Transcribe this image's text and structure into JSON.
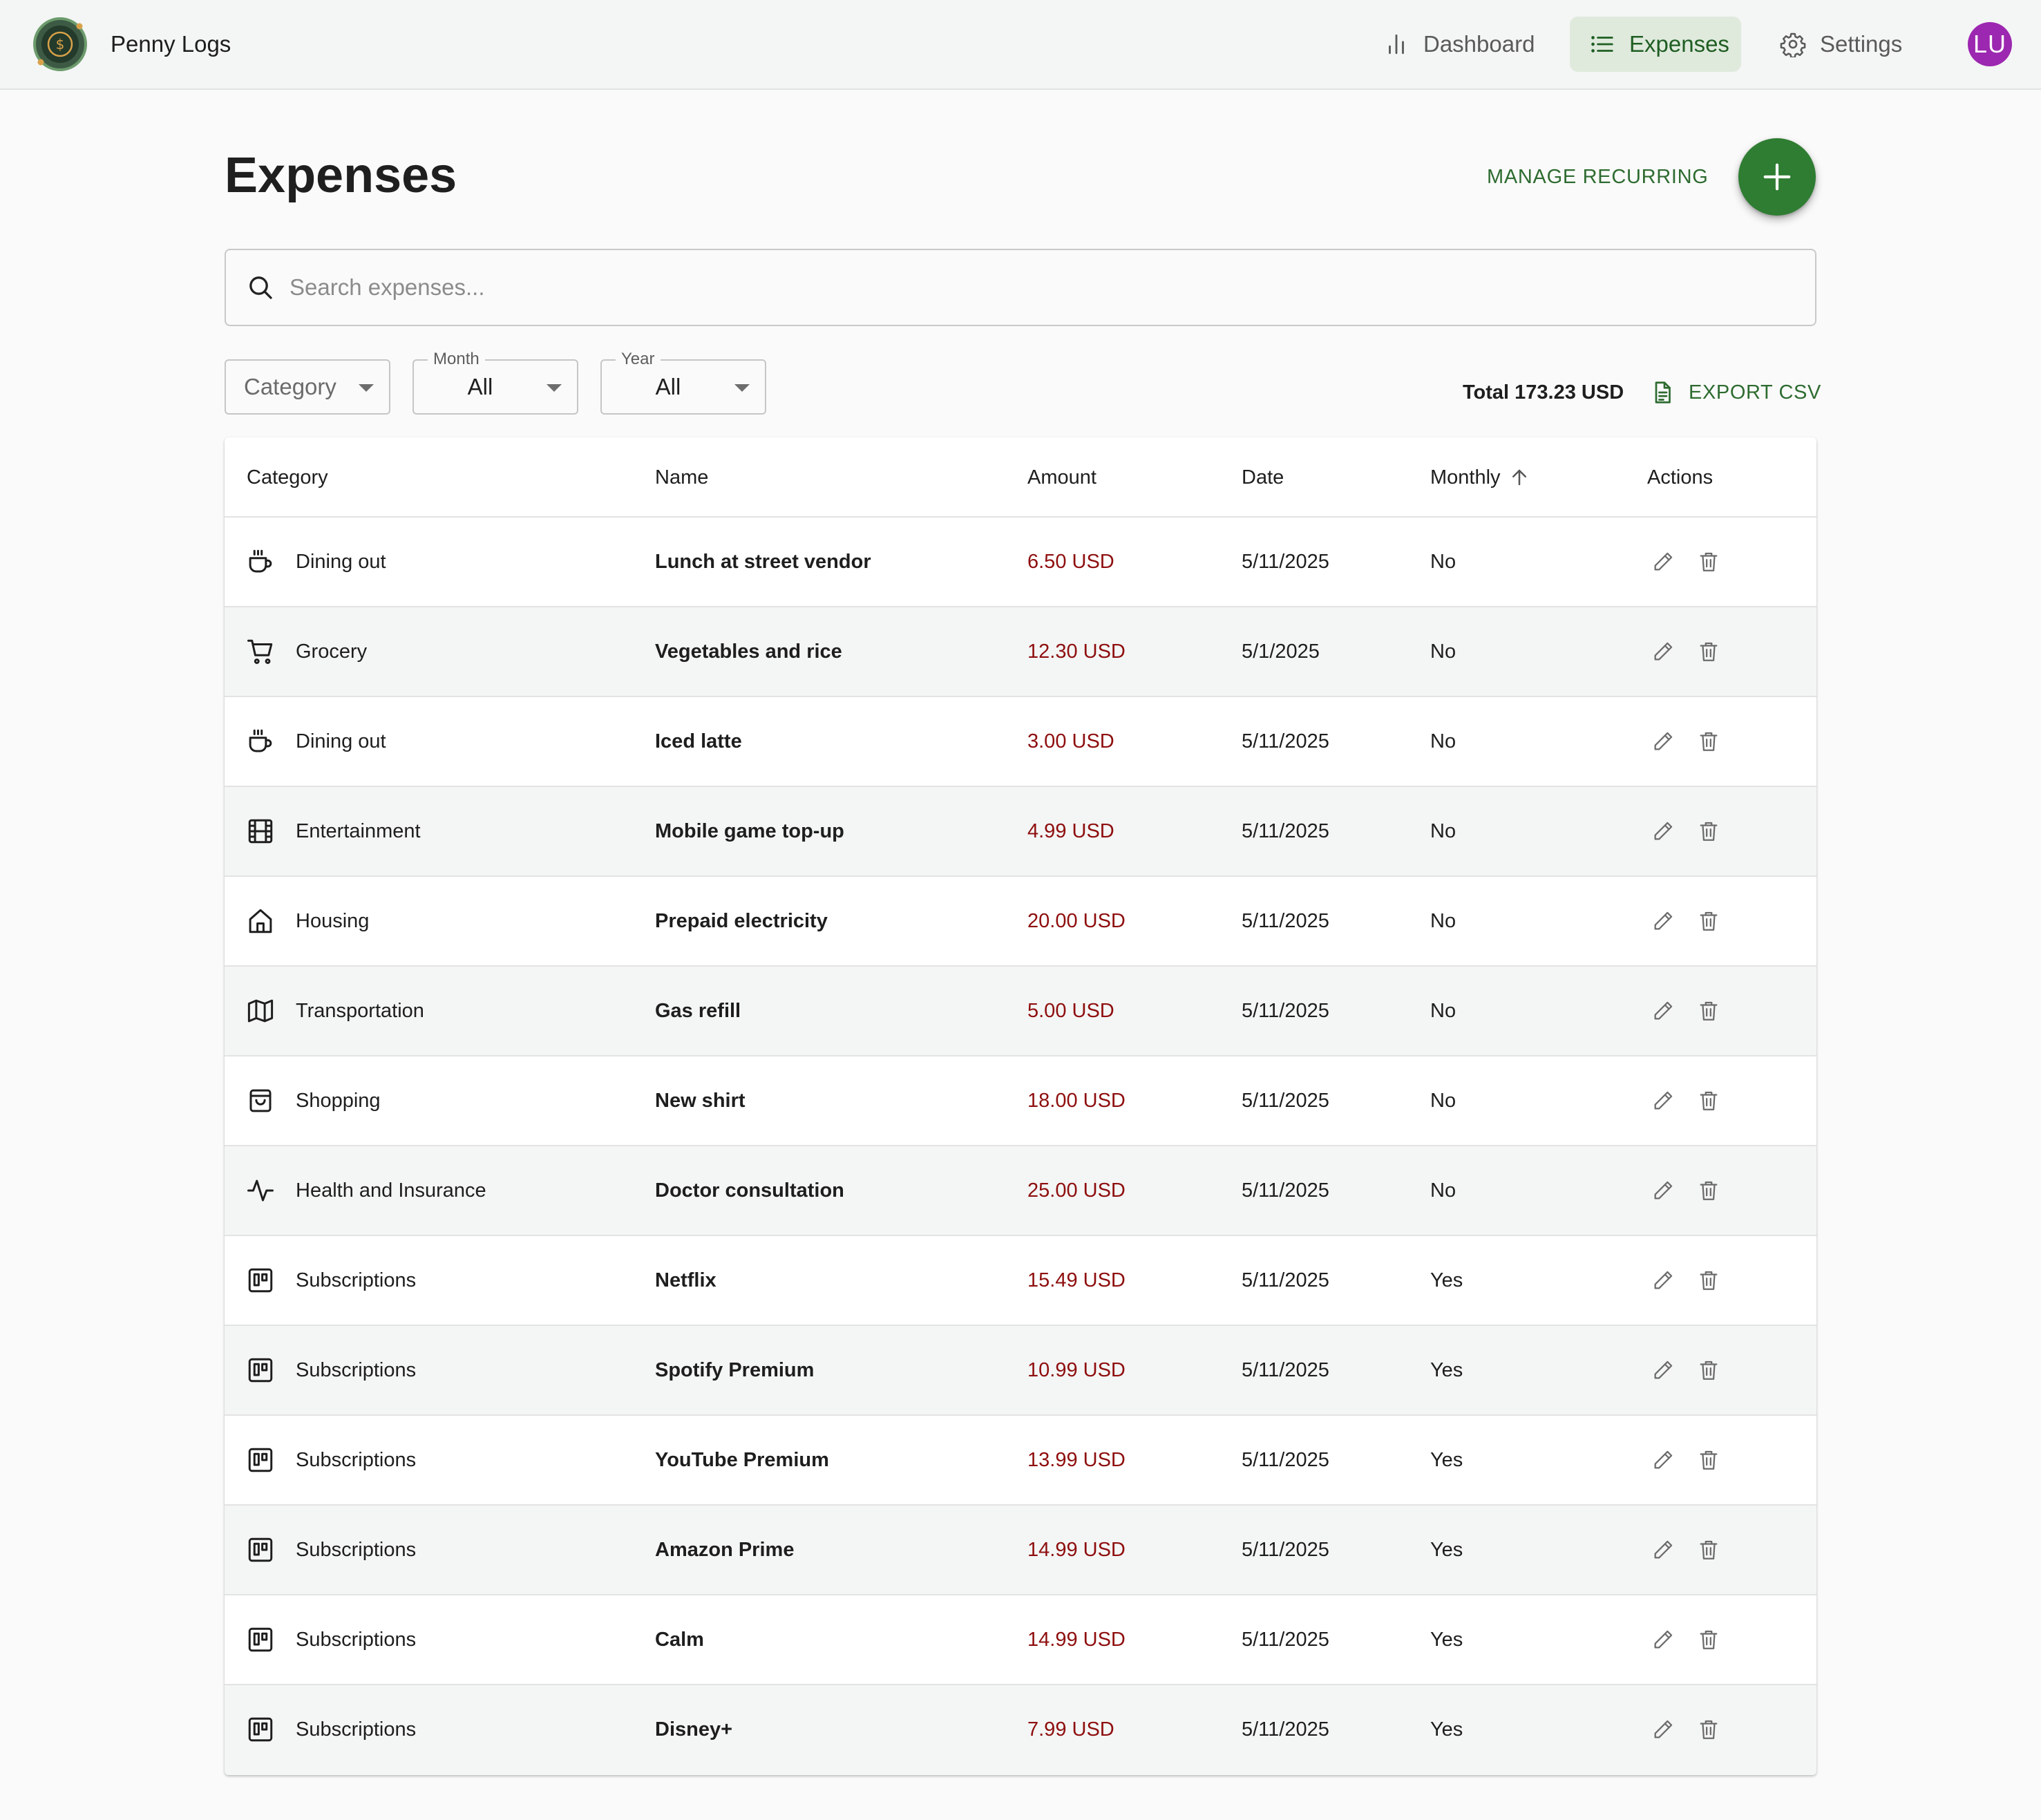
{
  "app": {
    "title": "Penny Logs"
  },
  "nav": {
    "dashboard": "Dashboard",
    "expenses": "Expenses",
    "settings": "Settings",
    "avatar_initials": "LU"
  },
  "page": {
    "title": "Expenses",
    "manage_recurring": "MANAGE RECURRING",
    "add_icon": "plus-icon"
  },
  "search": {
    "placeholder": "Search expenses..."
  },
  "filters": {
    "category": {
      "placeholder": "Category"
    },
    "month": {
      "label": "Month",
      "value": "All"
    },
    "year": {
      "label": "Year",
      "value": "All"
    }
  },
  "summary": {
    "total": "Total 173.23 USD",
    "export_label": "EXPORT CSV"
  },
  "table": {
    "headers": {
      "category": "Category",
      "name": "Name",
      "amount": "Amount",
      "date": "Date",
      "monthly": "Monthly",
      "actions": "Actions"
    },
    "sort": {
      "column": "Monthly",
      "direction": "ascending"
    },
    "rows": [
      {
        "icon": "coffee-cup-icon",
        "category": "Dining out",
        "name": "Lunch at street vendor",
        "amount": "6.50 USD",
        "date": "5/11/2025",
        "monthly": "No"
      },
      {
        "icon": "shopping-cart-icon",
        "category": "Grocery",
        "name": "Vegetables and rice",
        "amount": "12.30 USD",
        "date": "5/1/2025",
        "monthly": "No"
      },
      {
        "icon": "coffee-cup-icon",
        "category": "Dining out",
        "name": "Iced latte",
        "amount": "3.00 USD",
        "date": "5/11/2025",
        "monthly": "No"
      },
      {
        "icon": "film-icon",
        "category": "Entertainment",
        "name": "Mobile game top-up",
        "amount": "4.99 USD",
        "date": "5/11/2025",
        "monthly": "No"
      },
      {
        "icon": "home-icon",
        "category": "Housing",
        "name": "Prepaid electricity",
        "amount": "20.00 USD",
        "date": "5/11/2025",
        "monthly": "No"
      },
      {
        "icon": "map-icon",
        "category": "Transportation",
        "name": "Gas refill",
        "amount": "5.00 USD",
        "date": "5/11/2025",
        "monthly": "No"
      },
      {
        "icon": "shopping-bag-icon",
        "category": "Shopping",
        "name": "New shirt",
        "amount": "18.00 USD",
        "date": "5/11/2025",
        "monthly": "No"
      },
      {
        "icon": "activity-icon",
        "category": "Health and Insurance",
        "name": "Doctor consultation",
        "amount": "25.00 USD",
        "date": "5/11/2025",
        "monthly": "No"
      },
      {
        "icon": "subscription-icon",
        "category": "Subscriptions",
        "name": "Netflix",
        "amount": "15.49 USD",
        "date": "5/11/2025",
        "monthly": "Yes"
      },
      {
        "icon": "subscription-icon",
        "category": "Subscriptions",
        "name": "Spotify Premium",
        "amount": "10.99 USD",
        "date": "5/11/2025",
        "monthly": "Yes"
      },
      {
        "icon": "subscription-icon",
        "category": "Subscriptions",
        "name": "YouTube Premium",
        "amount": "13.99 USD",
        "date": "5/11/2025",
        "monthly": "Yes"
      },
      {
        "icon": "subscription-icon",
        "category": "Subscriptions",
        "name": "Amazon Prime",
        "amount": "14.99 USD",
        "date": "5/11/2025",
        "monthly": "Yes"
      },
      {
        "icon": "subscription-icon",
        "category": "Subscriptions",
        "name": "Calm",
        "amount": "14.99 USD",
        "date": "5/11/2025",
        "monthly": "Yes"
      },
      {
        "icon": "subscription-icon",
        "category": "Subscriptions",
        "name": "Disney+",
        "amount": "7.99 USD",
        "date": "5/11/2025",
        "monthly": "Yes"
      }
    ]
  },
  "colors": {
    "primary": "#2e7d32",
    "nav_active_bg": "#dfeadd",
    "amount_text": "#8e0e0e",
    "avatar_bg": "#9c27b0"
  }
}
